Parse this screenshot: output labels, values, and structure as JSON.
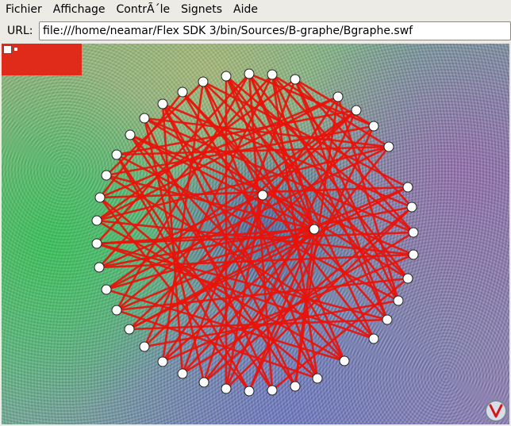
{
  "menu": {
    "items": [
      "Fichier",
      "Affichage",
      "ContrÃ´le",
      "Signets",
      "Aide"
    ]
  },
  "address": {
    "label": "URL:",
    "value": "file:///home/neamar/Flex SDK 3/bin/Sources/B-graphe/Bgraphe.swf"
  },
  "flash": {
    "panel_color": "#e02a1a",
    "edge_color": "#e8120a",
    "node_count": 44,
    "logo": "adobe-flash-v-icon"
  }
}
